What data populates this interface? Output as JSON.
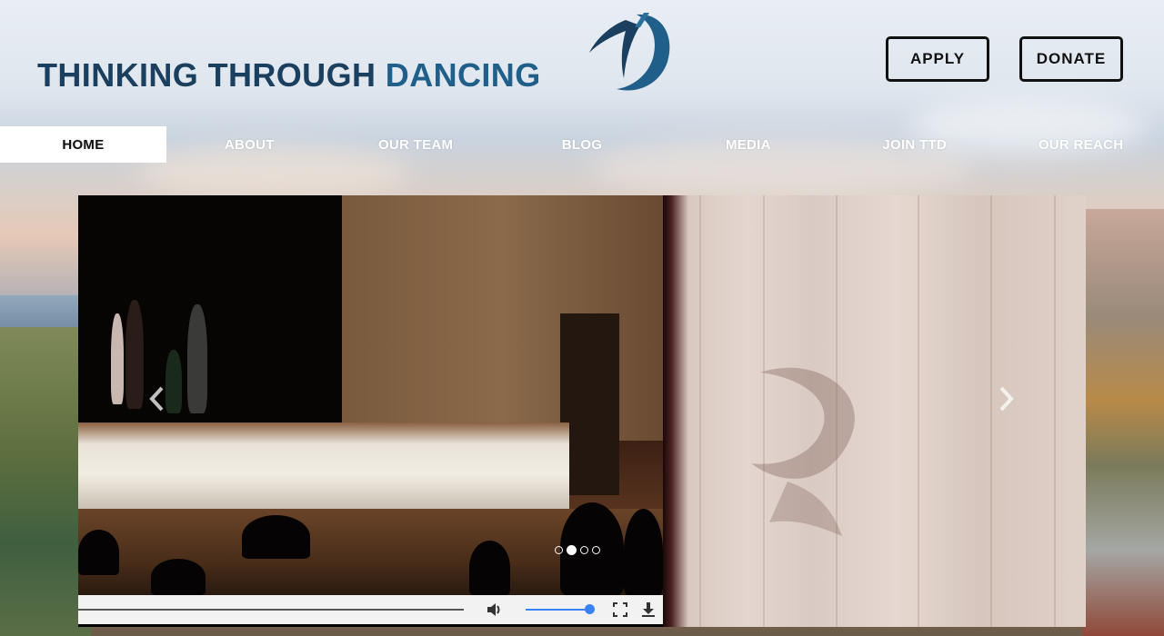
{
  "header": {
    "logo_text_primary": "THINKING THROUGH",
    "logo_text_accent": "DANCING",
    "apply_label": "APPLY",
    "donate_label": "DONATE"
  },
  "nav": {
    "items": [
      {
        "label": "HOME",
        "active": true
      },
      {
        "label": "ABOUT"
      },
      {
        "label": "OUR TEAM"
      },
      {
        "label": "BLOG"
      },
      {
        "label": "MEDIA"
      },
      {
        "label": "JOIN TTD"
      },
      {
        "label": "OUR REACH"
      }
    ]
  },
  "slider": {
    "prev_icon": "chevron-left-icon",
    "next_icon": "chevron-right-icon",
    "slide_count": 4,
    "active_slide": 2
  },
  "video": {
    "progress": 1.0,
    "volume": 0.95,
    "icons": [
      "volume-icon",
      "fullscreen-icon",
      "download-icon"
    ]
  },
  "colors": {
    "logo_dark": "#1b3f5e",
    "logo_accent": "#1f5f8a",
    "volume_accent": "#3b82f6"
  }
}
